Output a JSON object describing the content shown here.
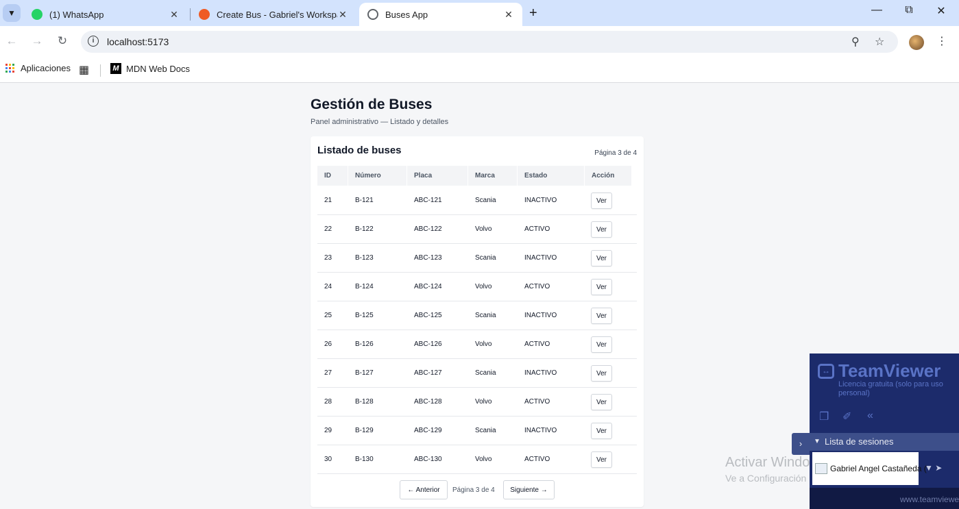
{
  "browser": {
    "tabs": [
      {
        "title": "(1) WhatsApp",
        "icon": "whatsapp-icon",
        "color": "#25d366"
      },
      {
        "title": "Create Bus - Gabriel's Workspace",
        "icon": "postman-icon",
        "color": "#ef5b25"
      },
      {
        "title": "Buses App",
        "icon": "globe-icon",
        "color": "#5f6368"
      }
    ],
    "url": "localhost:5173",
    "bookmarks": {
      "apps_label": "Aplicaciones",
      "mdn_label": "MDN Web Docs",
      "mdn_logo": "M"
    }
  },
  "page": {
    "title": "Gestión de Buses",
    "subtitle": "Panel administrativo — Listado y detalles"
  },
  "card": {
    "title": "Listado de buses",
    "page_info": "Página 3 de 4",
    "columns": [
      "ID",
      "Número",
      "Placa",
      "Marca",
      "Estado",
      "Acción"
    ],
    "view_label": "Ver",
    "rows": [
      {
        "id": "21",
        "numero": "B-121",
        "placa": "ABC-121",
        "marca": "Scania",
        "estado": "INACTIVO"
      },
      {
        "id": "22",
        "numero": "B-122",
        "placa": "ABC-122",
        "marca": "Volvo",
        "estado": "ACTIVO"
      },
      {
        "id": "23",
        "numero": "B-123",
        "placa": "ABC-123",
        "marca": "Scania",
        "estado": "INACTIVO"
      },
      {
        "id": "24",
        "numero": "B-124",
        "placa": "ABC-124",
        "marca": "Volvo",
        "estado": "ACTIVO"
      },
      {
        "id": "25",
        "numero": "B-125",
        "placa": "ABC-125",
        "marca": "Scania",
        "estado": "INACTIVO"
      },
      {
        "id": "26",
        "numero": "B-126",
        "placa": "ABC-126",
        "marca": "Volvo",
        "estado": "ACTIVO"
      },
      {
        "id": "27",
        "numero": "B-127",
        "placa": "ABC-127",
        "marca": "Scania",
        "estado": "INACTIVO"
      },
      {
        "id": "28",
        "numero": "B-128",
        "placa": "ABC-128",
        "marca": "Volvo",
        "estado": "ACTIVO"
      },
      {
        "id": "29",
        "numero": "B-129",
        "placa": "ABC-129",
        "marca": "Scania",
        "estado": "INACTIVO"
      },
      {
        "id": "30",
        "numero": "B-130",
        "placa": "ABC-130",
        "marca": "Volvo",
        "estado": "ACTIVO"
      }
    ],
    "pager": {
      "prev_label": "← Anterior",
      "page_text": "Página 3 de 4",
      "next_label": "Siguiente →"
    }
  },
  "watermark": {
    "line1": "Activar Windows",
    "line2": "Ve a Configuración para activar Windows."
  },
  "teamviewer": {
    "brand": "TeamViewer",
    "license": "Licencia gratuita (solo para uso personal)",
    "sessions_label": "Lista de sesiones",
    "user": "Gabriel Angel Castañeda (",
    "url": "www.teamviewer"
  }
}
